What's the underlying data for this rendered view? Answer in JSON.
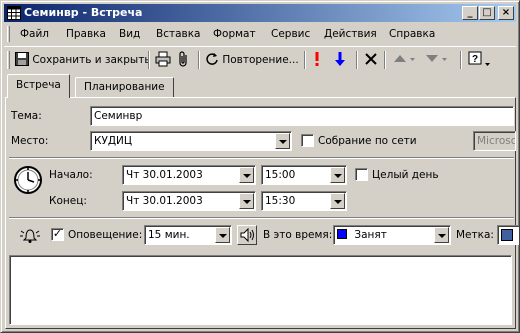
{
  "window": {
    "title": "Семинвр - Встреча",
    "controls": [
      "_",
      "□",
      "×"
    ]
  },
  "menu": [
    {
      "label": "Файл"
    },
    {
      "label": "Правка"
    },
    {
      "label": "Вид"
    },
    {
      "label": "Вставка"
    },
    {
      "label": "Формат"
    },
    {
      "label": "Сервис"
    },
    {
      "label": "Действия"
    },
    {
      "label": "Справка"
    }
  ],
  "toolbar": {
    "save_close": "Сохранить и закрыть",
    "recurrence": "Повторение...",
    "icons": [
      "save-icon",
      "print-icon",
      "paperclip-icon",
      "recurrence-icon",
      "high-importance-icon",
      "low-importance-icon",
      "delete-icon",
      "previous-item-icon",
      "next-item-icon",
      "help-icon"
    ],
    "importance_high_color": "#ff0000",
    "importance_low_color": "#0000ff"
  },
  "tabs": [
    {
      "label": "Встреча",
      "active": true
    },
    {
      "label": "Планирование",
      "active": false
    }
  ],
  "form": {
    "subject_label": "Тема:",
    "subject_value": "Семинвр",
    "location_label": "Место:",
    "location_value": "КУДИЦ",
    "online_meeting_label": "Собрание по сети",
    "online_meeting_checked": false,
    "directory_value": "Microso",
    "start_label": "Начало:",
    "start_date": "Чт 30.01.2003",
    "start_time": "15:00",
    "all_day_label": "Целый день",
    "all_day_checked": false,
    "end_label": "Конец:",
    "end_date": "Чт 30.01.2003",
    "end_time": "15:30",
    "reminder_checkmark": "✓",
    "reminder_checked": true,
    "reminder_label": "Оповещение:",
    "reminder_value": "15 мин.",
    "show_as_label": "В это время:",
    "show_as_value": "Занят",
    "show_as_color": "#0000ff",
    "label_label": "Метка:",
    "notes": ""
  }
}
